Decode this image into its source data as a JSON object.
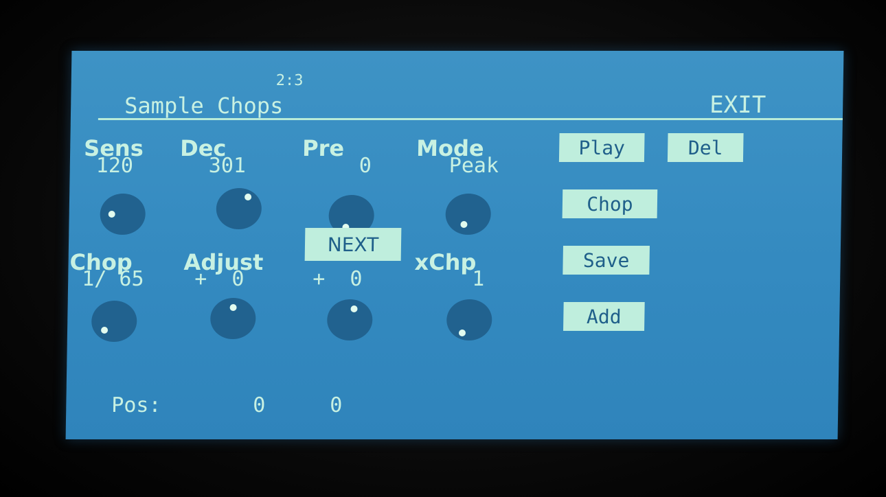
{
  "header": {
    "page_indicator": "2:3",
    "title": "Sample Chops",
    "exit_label": "EXIT"
  },
  "row1": [
    {
      "label": "Sens",
      "value": "120"
    },
    {
      "label": "Dec",
      "value": "301"
    },
    {
      "label": "Pre",
      "value": "0"
    },
    {
      "label": "Mode",
      "value": "Peak"
    }
  ],
  "row2": [
    {
      "label": "Chop",
      "value": "1/ 65"
    },
    {
      "label": "Adjust",
      "value": "+  0"
    },
    {
      "label": "",
      "value": "+  0"
    },
    {
      "label": "xChp",
      "value": "1"
    }
  ],
  "next_label": "NEXT",
  "buttons": {
    "play": "Play",
    "del": "Del",
    "chop": "Chop",
    "save": "Save",
    "add": "Add"
  },
  "footer": {
    "pos_label": "Pos:",
    "pos_value_1": "0",
    "pos_value_2": "0"
  },
  "colors": {
    "screen": "#3a8fc3",
    "text": "#c8f1e2",
    "knob": "#21628f",
    "button_bg": "#bfeedd",
    "button_text": "#1f5f8a"
  }
}
